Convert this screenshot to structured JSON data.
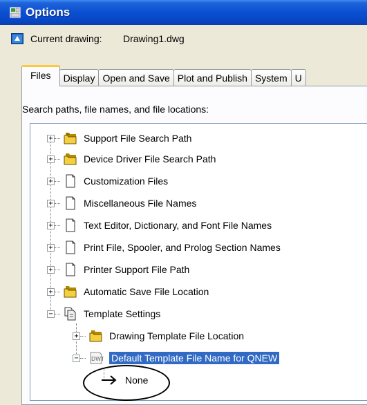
{
  "window": {
    "title": "Options"
  },
  "current_drawing": {
    "label": "Current drawing:",
    "value": "Drawing1.dwg"
  },
  "tabs": [
    "Files",
    "Display",
    "Open and Save",
    "Plot and Publish",
    "System",
    "U"
  ],
  "panel": {
    "label": "Search paths, file names, and file locations:"
  },
  "tree": {
    "items": [
      {
        "label": "Support File Search Path",
        "icon": "folder-stack-icon"
      },
      {
        "label": "Device Driver File Search Path",
        "icon": "folder-stack-icon"
      },
      {
        "label": "Customization Files",
        "icon": "file-icon"
      },
      {
        "label": "Miscellaneous File Names",
        "icon": "file-icon"
      },
      {
        "label": "Text Editor, Dictionary, and Font File Names",
        "icon": "file-icon"
      },
      {
        "label": "Print File, Spooler, and Prolog Section Names",
        "icon": "file-icon"
      },
      {
        "label": "Printer Support File Path",
        "icon": "file-icon"
      },
      {
        "label": "Automatic Save File Location",
        "icon": "folder-stack-icon"
      },
      {
        "label": "Template Settings",
        "icon": "documents-icon"
      },
      {
        "label": "Drawing Template File Location",
        "icon": "folder-stack-icon"
      },
      {
        "label": "Default Template File Name for QNEW",
        "icon": "dwt-file-icon"
      },
      {
        "label": "None",
        "icon": "arrow-right-icon"
      }
    ]
  },
  "colors": {
    "titlebar": "#0a4fd2",
    "selection": "#316ac5",
    "active_tab_accent": "#ffc83c"
  }
}
